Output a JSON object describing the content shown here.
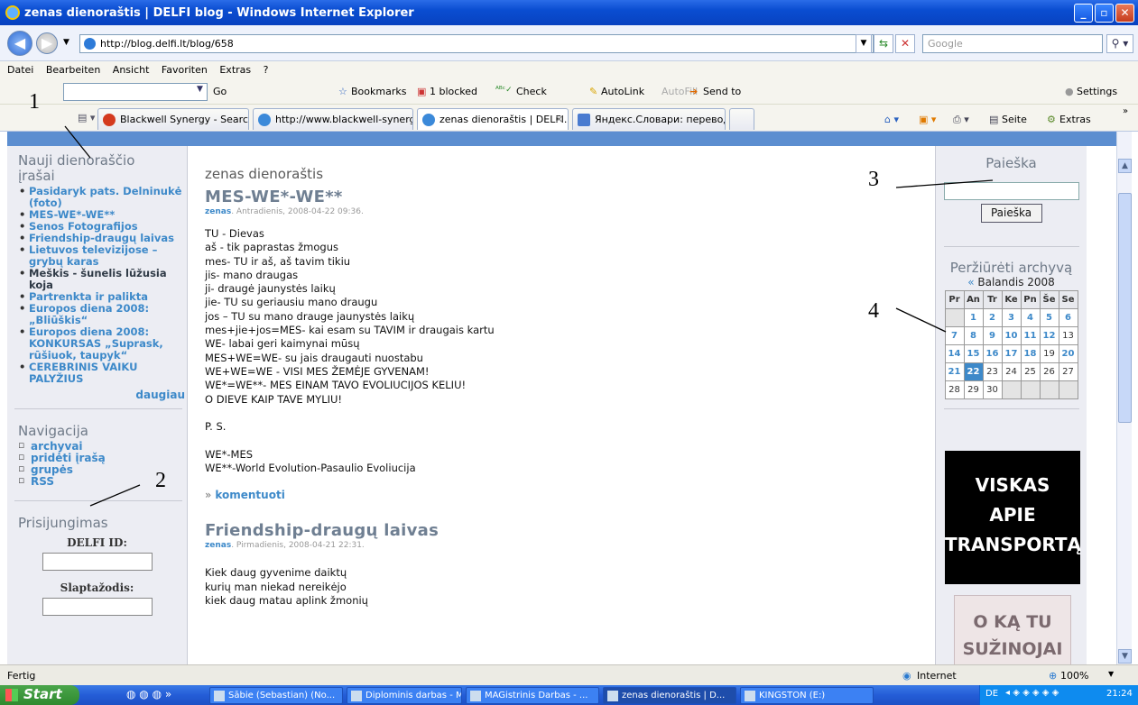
{
  "window": {
    "title": "zenas dienoraštis | DELFI blog - Windows Internet Explorer",
    "buttons": [
      "_",
      "▫",
      "✕"
    ]
  },
  "address_bar": {
    "url": "http://blog.delfi.lt/blog/658",
    "search_placeholder": "Google"
  },
  "menu": {
    "items": [
      "Datei",
      "Bearbeiten",
      "Ansicht",
      "Favoriten",
      "Extras",
      "?"
    ]
  },
  "links_toolbar": {
    "go": "Go",
    "bookmarks": "Bookmarks",
    "blocked": "1 blocked",
    "check": "Check",
    "autolink": "AutoLink",
    "autofill": "AutoFill",
    "send_to": "Send to",
    "settings": "Settings"
  },
  "tabs": [
    {
      "label": "Blackwell Synergy - Search R...",
      "color": "#d43a20"
    },
    {
      "label": "http://www.blackwell-synerg...",
      "color": "#3b89d9"
    },
    {
      "label": "zenas dienoraštis | DELFI...",
      "color": "#3b89d9"
    },
    {
      "label": "Яндекс.Словари: перевод ...",
      "color": "#4a7bd0"
    }
  ],
  "tab_close_glyph": "✕",
  "command_bar": {
    "page": "Seite",
    "extras": "Extras"
  },
  "left_sidebar": {
    "new_posts_heading": "Nauji dienoraščio įrašai",
    "new_posts": [
      {
        "text": "Pasidaryk pats. Delninukė (foto)",
        "plain": false
      },
      {
        "text": "MES-WE*-WE**",
        "plain": false
      },
      {
        "text": "Senos Fotografijos",
        "plain": false
      },
      {
        "text": "Friendship-draugų laivas",
        "plain": false
      },
      {
        "text": "Lietuvos televizijose – grybų karas",
        "plain": false
      },
      {
        "text": "Meškis - šunelis lūžusia koja",
        "plain": true
      },
      {
        "text": "Partrenkta ir palikta",
        "plain": false
      },
      {
        "text": "Europos diena 2008: „Bliūškis“",
        "plain": false
      },
      {
        "text": "Europos diena 2008: KONKURSAS „Suprask, rūšiuok, taupyk“",
        "plain": false
      },
      {
        "text": "CEREBRINIS VAIKU PALYŽIUS",
        "plain": false
      }
    ],
    "more": "daugiau",
    "navigation_heading": "Navigacija",
    "navigation": [
      "archyvai",
      "pridėti įrašą",
      "grupės",
      "RSS"
    ],
    "login_heading": "Prisijungimas",
    "delfi_id_label": "DELFI ID:",
    "password_label": "Slaptažodis:"
  },
  "main": {
    "blog_name": "zenas dienoraštis",
    "posts": [
      {
        "title": "MES-WE*-WE**",
        "author": "zenas",
        "date": ". Antradienis, 2008-04-22 09:36.",
        "lines": [
          "TU - Dievas",
          "aš - tik paprastas žmogus",
          "mes- TU ir aš, aš tavim tikiu",
          "jis- mano draugas",
          "ji- draugė jaunystės laikų",
          "jie- TU su geriausiu mano draugu",
          "jos – TU su mano drauge jaunystės laikų",
          "mes+jie+jos=MES- kai esam su TAVIM ir draugais kartu",
          "WE- labai geri kaimynai mūsų",
          "MES+WE=WE- su jais draugauti nuostabu",
          "WE+WE=WE - VISI MES ŽEMĖJE GYVENAM!",
          "WE*=WE**- MES EINAM TAVO EVOLIUCIJOS KELIU!",
          "O DIEVE KAIP TAVE MYLIU!",
          "",
          "P. S.",
          "",
          "WE*-MES",
          "WE**-World Evolution-Pasaulio Evoliucija"
        ],
        "comment_link": "komentuoti",
        "comment_prefix": "»"
      },
      {
        "title": "Friendship-draugų laivas",
        "author": "zenas",
        "date": ". Pirmadienis, 2008-04-21 22:31.",
        "lines": [
          "Kiek daug gyvenime daiktų",
          "kurių man niekad nereikėjo",
          "kiek daug matau aplink žmonių"
        ]
      }
    ]
  },
  "right_sidebar": {
    "search_heading": "Paieška",
    "search_button": "Paieška",
    "archive_heading": "Peržiūrėti archyvą",
    "month_prev": "«",
    "month": "Balandis 2008",
    "weekdays": [
      "Pr",
      "An",
      "Tr",
      "Ke",
      "Pn",
      "Še",
      "Se"
    ],
    "weeks": [
      [
        "",
        "1",
        "2",
        "3",
        "4",
        "5",
        "6"
      ],
      [
        "7",
        "8",
        "9",
        "10",
        "11",
        "12",
        "13"
      ],
      [
        "14",
        "15",
        "16",
        "17",
        "18",
        "19",
        "20"
      ],
      [
        "21",
        "22",
        "23",
        "24",
        "25",
        "26",
        "27"
      ],
      [
        "28",
        "29",
        "30",
        "",
        "",
        "",
        ""
      ]
    ],
    "linked_days": [
      "1",
      "2",
      "3",
      "4",
      "5",
      "6",
      "7",
      "8",
      "9",
      "10",
      "11",
      "12",
      "14",
      "15",
      "16",
      "17",
      "18",
      "20",
      "21",
      "22"
    ],
    "today": "22",
    "ad1_lines": [
      "VISKAS",
      "APIE",
      "TRANSPORTĄ"
    ],
    "ad2_lines": [
      "O KĄ TU",
      "SUŽINOJAI"
    ]
  },
  "status_bar": {
    "status": "Fertig",
    "zone": "Internet",
    "zoom": "100%"
  },
  "taskbar": {
    "start": "Start",
    "tasks": [
      {
        "label": "Sābie (Sebastian) (No...",
        "active": false
      },
      {
        "label": "Diplominis darbas - Mi...",
        "active": false
      },
      {
        "label": "MAGistrinis Darbas - ...",
        "active": false
      },
      {
        "label": "zenas dienoraštis | D...",
        "active": true
      },
      {
        "label": "KINGSTON (E:)",
        "active": false
      }
    ],
    "lang": "DE",
    "clock": "21:24"
  },
  "annotations": [
    "1",
    "2",
    "3",
    "4"
  ]
}
